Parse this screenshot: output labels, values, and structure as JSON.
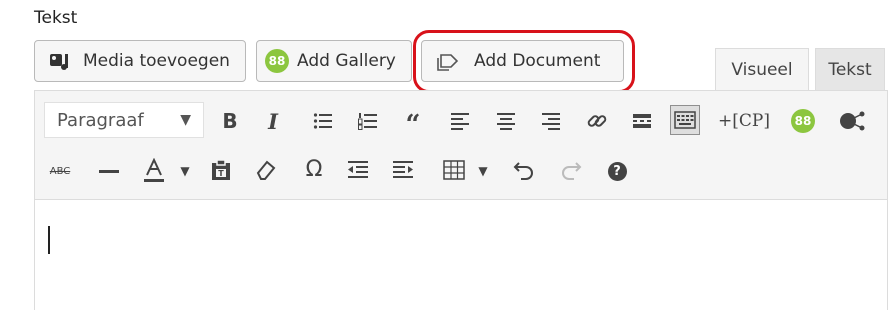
{
  "section_title": "Tekst",
  "buttons": {
    "media": "Media toevoegen",
    "gallery": "Add Gallery",
    "document": "Add Document"
  },
  "tabs": {
    "visual": "Visueel",
    "text": "Tekst"
  },
  "toolbar": {
    "format_select": "Paragraaf",
    "shortcode_label": "+[CP]",
    "strikethrough_label": "ABC",
    "gallery_badge": "88",
    "help_glyph": "?"
  },
  "colors": {
    "highlight_ring": "#d8121a",
    "gallery_green": "#8cc63f"
  },
  "icons": [
    "media-icon",
    "gallery-icon",
    "document-icon",
    "bold-icon",
    "italic-icon",
    "bullet-list-icon",
    "numbered-list-icon",
    "blockquote-icon",
    "align-left-icon",
    "align-center-icon",
    "align-right-icon",
    "link-icon",
    "read-more-icon",
    "toolbar-toggle-icon",
    "shortcode-icon",
    "gallery-insert-icon",
    "share-icon",
    "strikethrough-icon",
    "horizontal-line-icon",
    "text-color-icon",
    "paste-text-icon",
    "clear-format-icon",
    "special-char-icon",
    "outdent-icon",
    "indent-icon",
    "table-icon",
    "undo-icon",
    "redo-icon",
    "help-icon"
  ]
}
